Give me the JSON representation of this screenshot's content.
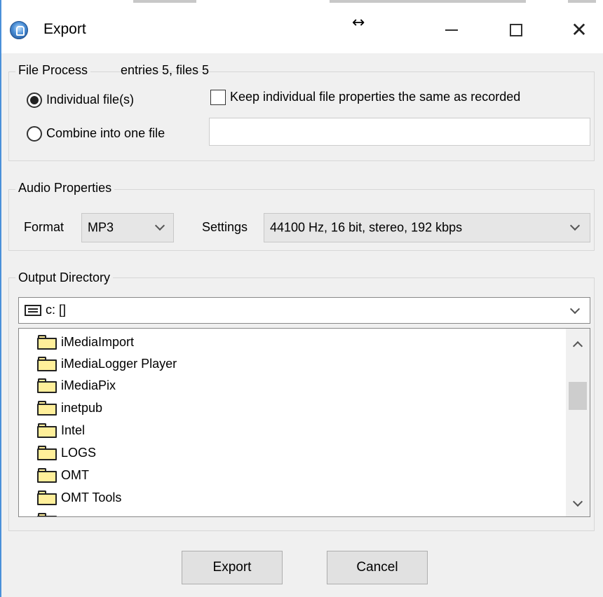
{
  "window": {
    "title": "Export",
    "resize_cursor_glyph": "↔",
    "close_glyph": "✕"
  },
  "file_process": {
    "legend": "File Process",
    "summary": "entries 5, files 5",
    "individual_label": "Individual file(s)",
    "individual_selected": true,
    "combine_label": "Combine into one file",
    "combine_selected": false,
    "combine_filename": "",
    "keep_props_label": "Keep individual file properties the same as recorded",
    "keep_props_checked": false
  },
  "audio": {
    "legend": "Audio Properties",
    "format_label": "Format",
    "format_value": "MP3",
    "settings_label": "Settings",
    "settings_value": "44100 Hz, 16 bit, stereo, 192 kbps"
  },
  "output": {
    "legend": "Output Directory",
    "drive_value": "c: []",
    "folders": [
      "iMediaImport",
      "iMediaLogger Player",
      "iMediaPix",
      "inetpub",
      "Intel",
      "LOGS",
      "OMT",
      "OMT Tools"
    ]
  },
  "buttons": {
    "export_label": "Export",
    "cancel_label": "Cancel"
  },
  "colors": {
    "window_bg": "#f0f0f0",
    "titlebar_bg": "#ffffff",
    "folder_fill": "#ffef9a",
    "button_bg": "#e1e1e1",
    "frame_accent": "#4a90d9"
  },
  "icons": {
    "app": "app-icon",
    "drive": "drive-icon",
    "folder": "folder-icon",
    "minimize": "minimize-icon",
    "maximize": "maximize-icon",
    "close": "close-icon"
  }
}
